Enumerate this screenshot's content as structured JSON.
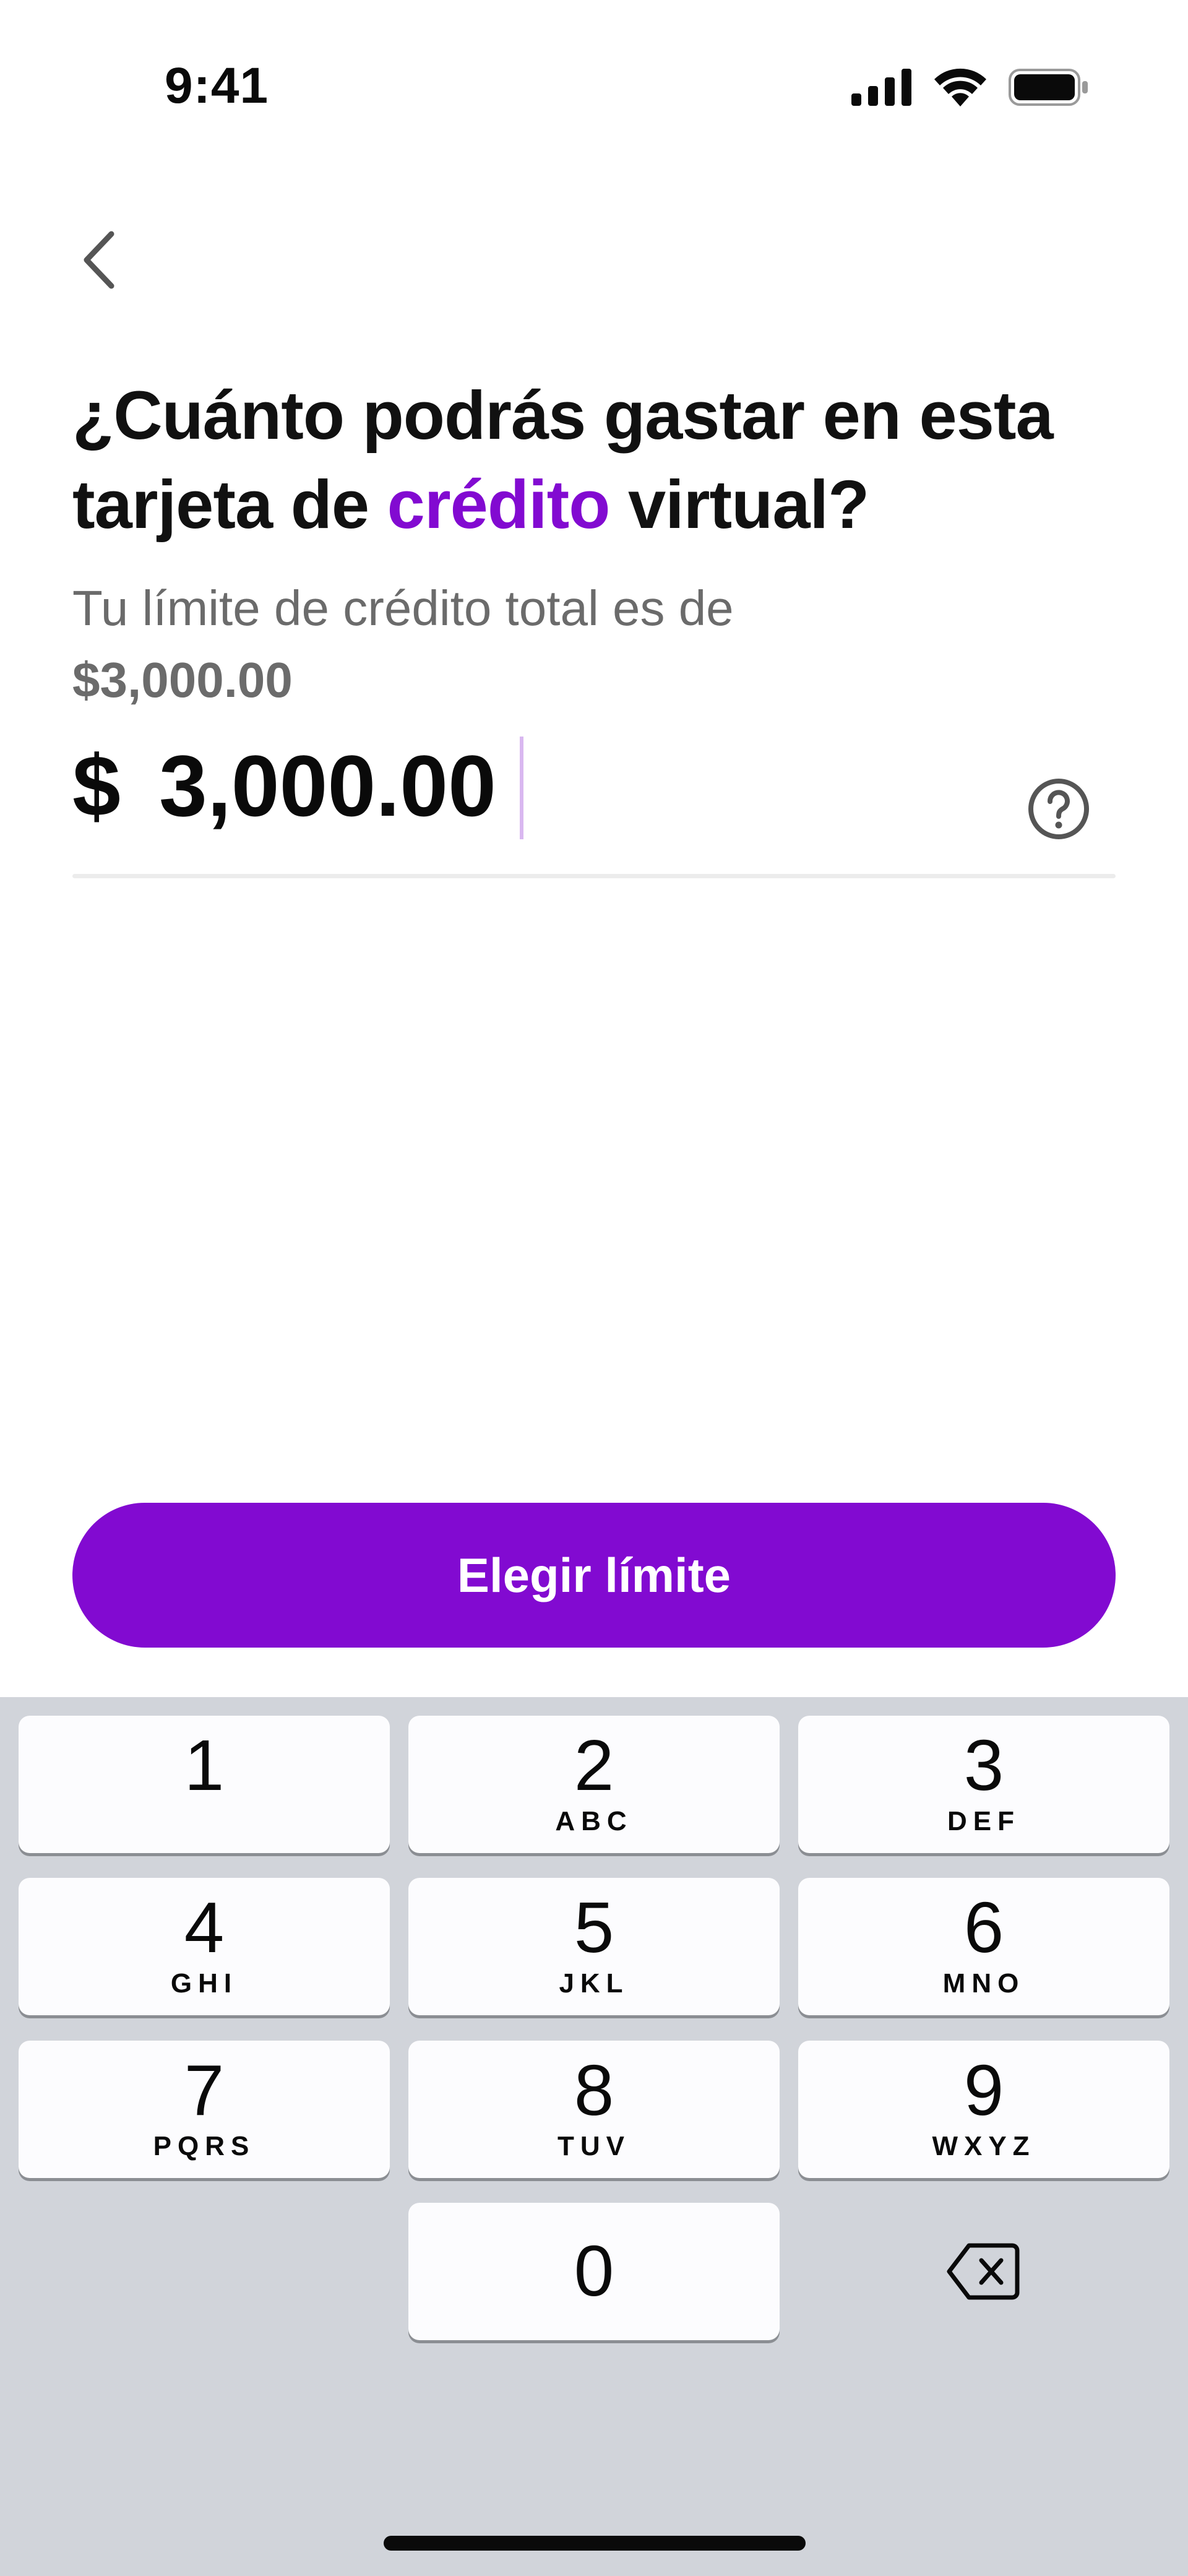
{
  "status_bar": {
    "time": "9:41",
    "icons": [
      "signal-icon",
      "wifi-icon",
      "battery-icon"
    ]
  },
  "nav": {
    "back_icon": "chevron-left-icon"
  },
  "header": {
    "title_part1": "¿Cuánto podrás gastar en esta tarjeta de ",
    "title_accent": "crédito",
    "title_part2": " virtual?",
    "subtitle_prefix": "Tu límite de crédito total es de ",
    "subtitle_amount": "$3,000.00"
  },
  "amount_field": {
    "currency_symbol": "$",
    "value": "3,000.00",
    "help_icon": "question-circle-icon"
  },
  "primary_action": {
    "label": "Elegir límite"
  },
  "keypad": {
    "keys": [
      {
        "digit": "1",
        "letters": ""
      },
      {
        "digit": "2",
        "letters": "ABC"
      },
      {
        "digit": "3",
        "letters": "DEF"
      },
      {
        "digit": "4",
        "letters": "GHI"
      },
      {
        "digit": "5",
        "letters": "JKL"
      },
      {
        "digit": "6",
        "letters": "MNO"
      },
      {
        "digit": "7",
        "letters": "PQRS"
      },
      {
        "digit": "8",
        "letters": "TUV"
      },
      {
        "digit": "9",
        "letters": "WXYZ"
      },
      {
        "digit": "0",
        "letters": ""
      }
    ],
    "backspace_icon": "backspace-icon"
  },
  "colors": {
    "accent": "#820ad1",
    "keyboard_bg": "#d1d4da",
    "key_bg": "#fcfcfe",
    "muted_text": "#6b6b6b"
  }
}
